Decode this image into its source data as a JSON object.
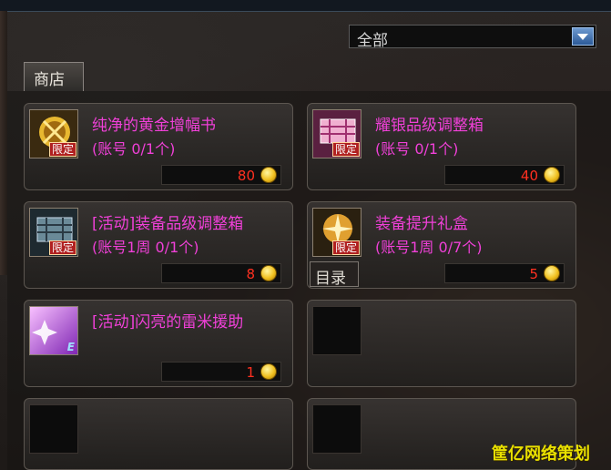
{
  "filter": {
    "selected": "全部"
  },
  "tab": {
    "label": "商店"
  },
  "items": [
    {
      "name": "纯净的黄金增幅书",
      "limit": "(账号 0/1个)",
      "price": "80",
      "badge": "限定"
    },
    {
      "name": "耀银品级调整箱",
      "limit": "(账号 0/1个)",
      "price": "40",
      "badge": "限定"
    },
    {
      "name": "[活动]装备品级调整箱",
      "limit": "(账号1周 0/1个)",
      "price": "8",
      "badge": "限定"
    },
    {
      "name": "装备提升礼盒",
      "limit": "(账号1周 0/7个)",
      "price": "5",
      "badge": "限定"
    },
    {
      "name": "[活动]闪亮的雷米援助",
      "price": "1",
      "badge": "E"
    }
  ],
  "catalog_button": {
    "label": "目录"
  },
  "watermark": "筐亿网络策划",
  "colors": {
    "item_name": "#f040d8",
    "price": "#ff3020",
    "dropdown_button": "#3a6aa8"
  }
}
